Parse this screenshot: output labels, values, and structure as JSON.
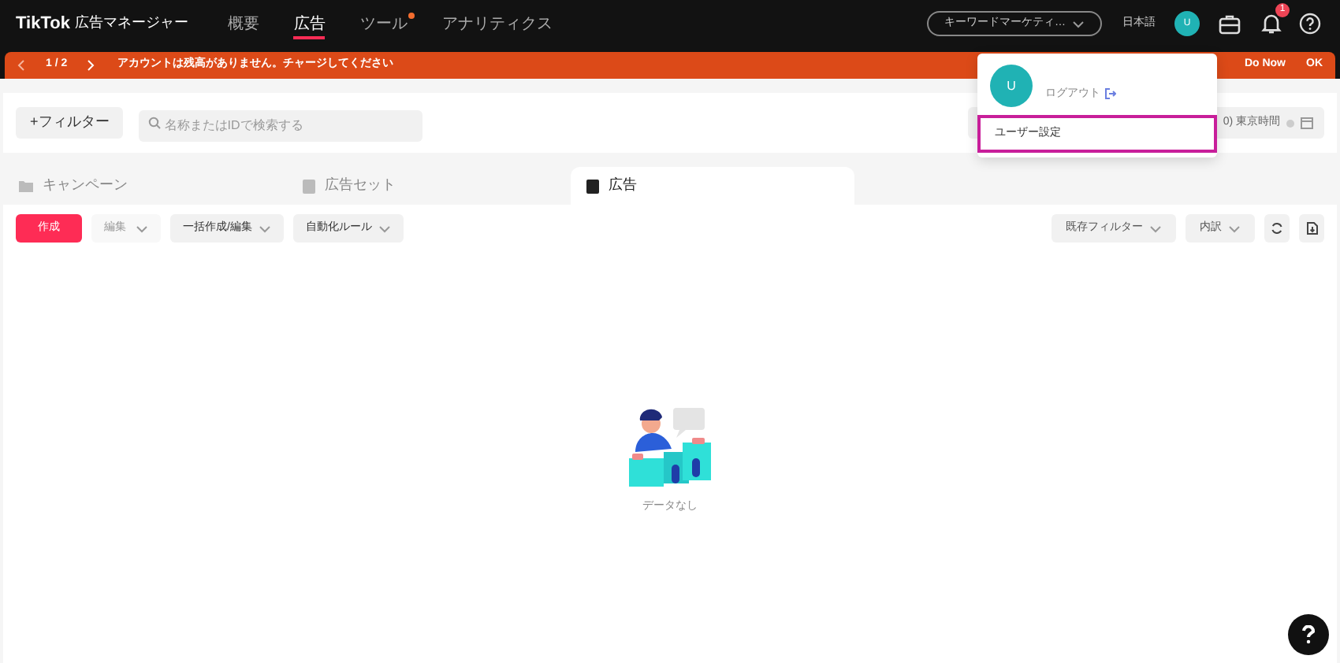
{
  "header": {
    "logo": "TikTok",
    "product": "広告マネージャー",
    "nav": [
      {
        "label": "概要",
        "selected": false,
        "dot": false
      },
      {
        "label": "広告",
        "selected": true,
        "dot": false
      },
      {
        "label": "ツール",
        "selected": false,
        "dot": true
      },
      {
        "label": "アナリティクス",
        "selected": false,
        "dot": false
      }
    ],
    "account_select": "キーワードマーケティ…",
    "language": "日本語",
    "avatar": "U",
    "notification_count": "1"
  },
  "banner": {
    "page": "1",
    "separator": "/",
    "total": "2",
    "message": "アカウントは残高がありません。チャージしてください",
    "actions": [
      "Do Now",
      "OK"
    ]
  },
  "filter_bar": {
    "add_filter": "+フィルター",
    "search_placeholder": "名称またはIDで検索する",
    "date_field": "0) 東京時間"
  },
  "level_tabs": [
    {
      "label": "キャンペーン",
      "selected": false
    },
    {
      "label": "広告セット",
      "selected": false
    },
    {
      "label": "広告",
      "selected": true
    }
  ],
  "toolbar": {
    "left": [
      {
        "label": "作成",
        "kind": "primary",
        "disabled": false
      },
      {
        "label": "編集",
        "kind": "dropdown",
        "disabled": true
      },
      {
        "label": "一括作成/編集",
        "kind": "dropdown",
        "disabled": false
      },
      {
        "label": "自動化ルール",
        "kind": "dropdown",
        "disabled": false
      }
    ],
    "right": [
      {
        "label": "既存フィルター",
        "kind": "dropdown"
      },
      {
        "label": "内訳",
        "kind": "dropdown"
      }
    ]
  },
  "empty_state": {
    "text": "データなし"
  },
  "user_menu": {
    "avatar": "U",
    "logout": "ログアウト",
    "items": [
      {
        "label": "ユーザー設定",
        "highlighted": true
      }
    ]
  }
}
